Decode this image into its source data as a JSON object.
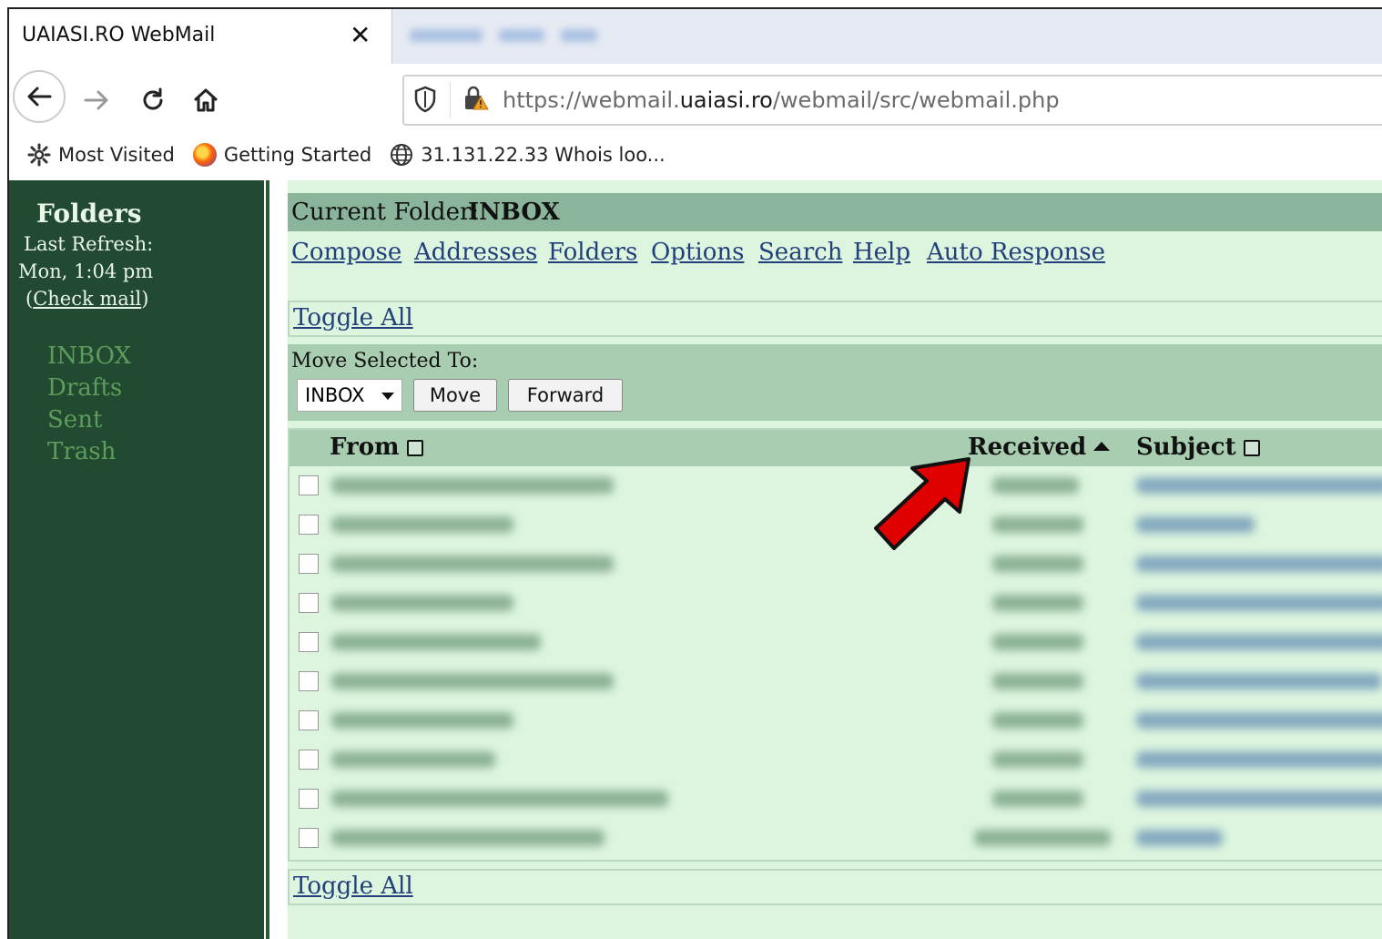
{
  "browser": {
    "tab_title": "UAIASI.RO WebMail",
    "tab_close": "✕",
    "url_prefix": "https://webmail.",
    "url_domain": "uaiasi.ro",
    "url_suffix": "/webmail/src/webmail.php",
    "bookmarks": [
      {
        "label": "Most Visited",
        "icon": "gear-icon"
      },
      {
        "label": "Getting Started",
        "icon": "firefox-icon"
      },
      {
        "label": "31.131.22.33 Whois loo...",
        "icon": "globe-icon"
      }
    ]
  },
  "sidebar": {
    "title": "Folders",
    "last_refresh_label": "Last Refresh:",
    "last_refresh_time": "Mon, 1:04 pm",
    "check_mail_open": "(",
    "check_mail": "Check mail",
    "check_mail_close": ")",
    "folders": [
      "INBOX",
      "Drafts",
      "Sent",
      "Trash"
    ]
  },
  "main": {
    "current_folder_label": "Current Folder:",
    "current_folder_value": "INBOX",
    "menu": [
      "Compose",
      "Addresses",
      "Folders",
      "Options",
      "Search",
      "Help",
      "Auto Response"
    ],
    "toggle_all": "Toggle All",
    "move_selected_label": "Move Selected To:",
    "move_target": "INBOX",
    "move_button": "Move",
    "forward_button": "Forward",
    "columns": {
      "from": "From",
      "received": "Received",
      "subject": "Subject"
    }
  },
  "colors": {
    "sidebar_bg": "#214a30",
    "main_bg": "#ddf5df",
    "header_bg": "#8ab59a",
    "link": "#21407a",
    "annotation_arrow": "#e00000"
  }
}
